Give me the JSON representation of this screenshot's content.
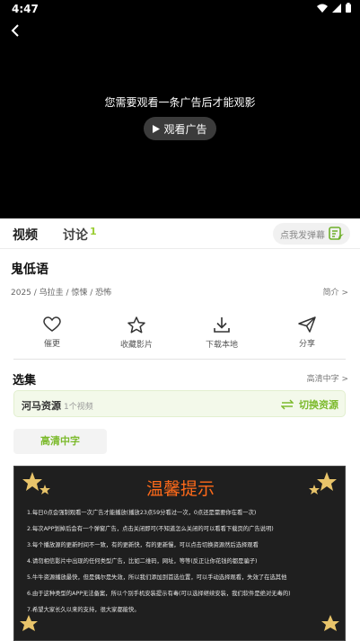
{
  "status": {
    "time": "4:47"
  },
  "player": {
    "ad_message": "您需要观看一条广告后才能观影",
    "ad_button": "观看广告"
  },
  "tabs": {
    "video": "视频",
    "discuss": "讨论",
    "discuss_count": "1",
    "danmu_placeholder": "点我发弹幕"
  },
  "movie": {
    "title": "鬼低语",
    "meta": "2025 / 乌拉圭 / 惊悚 / 恐怖",
    "intro_link": "简介 >"
  },
  "actions": [
    {
      "label": "催更",
      "icon": "heart-icon"
    },
    {
      "label": "收藏影片",
      "icon": "star-icon"
    },
    {
      "label": "下载本地",
      "icon": "download-icon"
    },
    {
      "label": "分享",
      "icon": "send-icon"
    }
  ],
  "episodes": {
    "title": "选集",
    "link": "高清中字 >",
    "source_name": "河马资源",
    "source_count": "1个视频",
    "switch_label": "切换资源",
    "quality": "高清中字"
  },
  "notice": {
    "title": "温馨提示",
    "lines": [
      "1.每日0点会强制观看一次广告才能播放(播放23点59分看过一次，0点还是需要你在看一次)",
      "2.每次APP划掉后会有一个弹窗广告，点击关闭即可(不知道怎么关闭的可以看看下载页的广告说明)",
      "3.每个播放源的更新时间不一致，有的更新快，有的更新慢，可以点击切换资源然后选择观看",
      "4.请勿相信影片中出现的任何类型广告，比如二维码，网址，等等(反正让你花钱的都是骗子)",
      "5.牛牛资源播放最快，但是偶尔是失效，所以我们添加到首选位置，可以手动选择观看，失效了在选其他",
      "6.由于这种类型的APP无法备案，所以个别手机安装提示有毒(可以选择继续安装，我们软件是绝对无毒的)",
      "7.希望大家长久以来的支持，很大家都能快。"
    ]
  },
  "colors": {
    "accent": "#7cba2c",
    "notice_title": "#ff6a1a"
  }
}
